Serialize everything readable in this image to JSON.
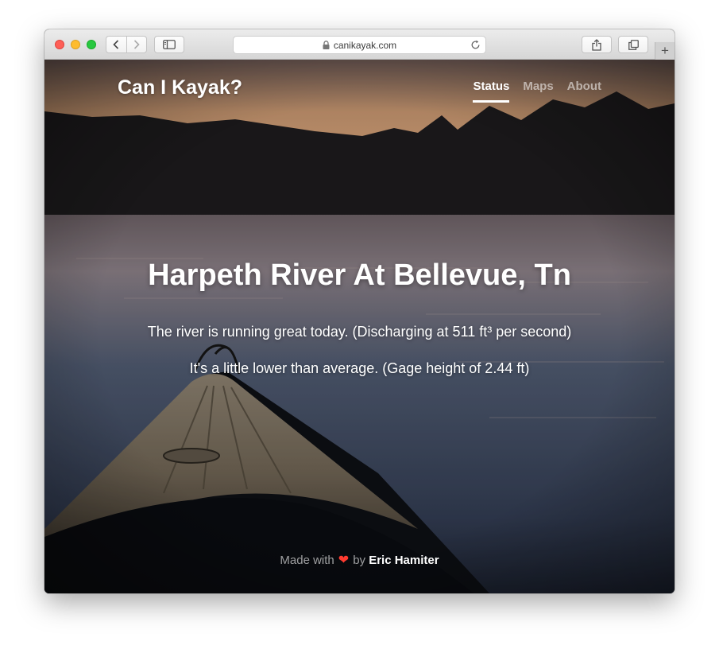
{
  "browser": {
    "url": "canikayak.com",
    "icons": {
      "back": "chevron-left-icon",
      "forward": "chevron-right-icon",
      "sidebar": "sidebar-icon",
      "lock": "lock-icon",
      "reload": "reload-icon",
      "share": "share-icon",
      "tabs": "tabs-icon",
      "new_tab": "plus-icon"
    },
    "new_tab_label": "+"
  },
  "site": {
    "brand": "Can I Kayak?",
    "nav": [
      {
        "label": "Status",
        "active": true
      },
      {
        "label": "Maps",
        "active": false
      },
      {
        "label": "About",
        "active": false
      }
    ],
    "hero": {
      "title": "Harpeth River At Bellevue, Tn",
      "line1": "The river is running great today. (Discharging at 511 ft³ per second)",
      "line2": "It's a little lower than average. (Gage height of 2.44 ft)"
    },
    "footer": {
      "prefix": "Made with",
      "heart": "❤",
      "by": "by",
      "author": "Eric Hamiter"
    }
  },
  "colors": {
    "heart": "#ff3b30",
    "text": "#ffffff"
  }
}
